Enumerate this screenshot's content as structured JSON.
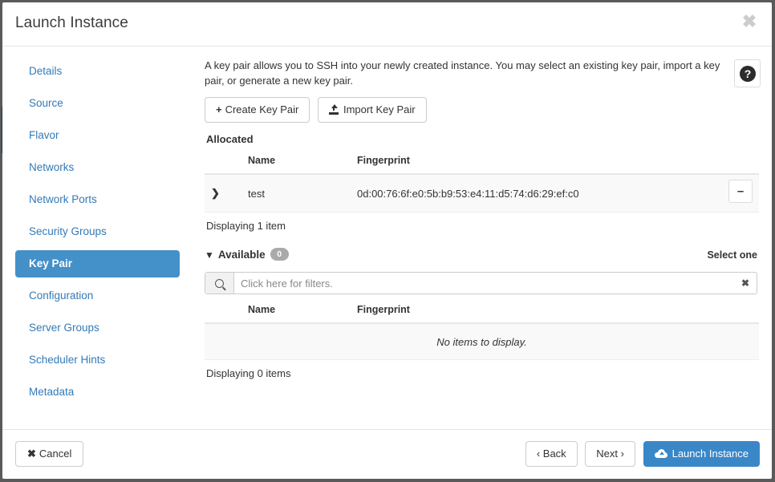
{
  "window": {
    "title": "Launch Instance",
    "close_icon": "close-icon"
  },
  "sidebar": {
    "items": [
      {
        "label": "Details",
        "active": false
      },
      {
        "label": "Source",
        "active": false
      },
      {
        "label": "Flavor",
        "active": false
      },
      {
        "label": "Networks",
        "active": false
      },
      {
        "label": "Network Ports",
        "active": false
      },
      {
        "label": "Security Groups",
        "active": false
      },
      {
        "label": "Key Pair",
        "active": true
      },
      {
        "label": "Configuration",
        "active": false
      },
      {
        "label": "Server Groups",
        "active": false
      },
      {
        "label": "Scheduler Hints",
        "active": false
      },
      {
        "label": "Metadata",
        "active": false
      }
    ]
  },
  "main": {
    "description": "A key pair allows you to SSH into your newly created instance. You may select an existing key pair, import a key pair, or generate a new key pair.",
    "help_icon": "question-mark-icon",
    "create_key_pair_label": "Create Key Pair",
    "create_key_pair_glyph": "+",
    "import_key_pair_label": "Import Key Pair",
    "allocated": {
      "heading": "Allocated",
      "columns": [
        "Name",
        "Fingerprint"
      ],
      "rows": [
        {
          "expand_glyph": "❯",
          "name": "test",
          "fingerprint": "0d:00:76:6f:e0:5b:b9:53:e4:11:d5:74:d6:29:ef:c0",
          "action_glyph": "–"
        }
      ],
      "footer": "Displaying 1 item"
    },
    "available": {
      "heading": "Available",
      "caret_glyph": "⌄",
      "count": "0",
      "select_hint": "Select one",
      "filter_placeholder": "Click here for filters.",
      "filter_value": "",
      "filter_clear_glyph": "✖",
      "columns": [
        "Name",
        "Fingerprint"
      ],
      "empty_message": "No items to display.",
      "footer": "Displaying 0 items"
    }
  },
  "footer": {
    "cancel_label": "Cancel",
    "cancel_glyph": "✖",
    "back_label": "‹ Back",
    "next_label": "Next ›",
    "launch_label": "Launch Instance"
  },
  "colors": {
    "link": "#337ab7",
    "active_nav": "#4490c9",
    "primary_button": "#3a87c8",
    "badge": "#aaaaaa",
    "backdrop": "#5a5a5a"
  }
}
